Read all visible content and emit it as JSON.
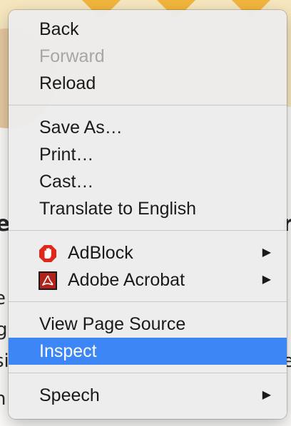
{
  "background_page": {
    "fragments": [
      "e",
      "r",
      "e",
      "g",
      "si",
      "ee",
      "h"
    ]
  },
  "context_menu": {
    "groups": [
      [
        {
          "label": "Back",
          "enabled": true
        },
        {
          "label": "Forward",
          "enabled": false
        },
        {
          "label": "Reload",
          "enabled": true
        }
      ],
      [
        {
          "label": "Save As…",
          "enabled": true
        },
        {
          "label": "Print…",
          "enabled": true
        },
        {
          "label": "Cast…",
          "enabled": true
        },
        {
          "label": "Translate to English",
          "enabled": true
        }
      ],
      [
        {
          "label": "AdBlock",
          "icon": "adblock-hand-icon",
          "submenu": true
        },
        {
          "label": "Adobe Acrobat",
          "icon": "adobe-acrobat-icon",
          "submenu": true
        }
      ],
      [
        {
          "label": "View Page Source",
          "enabled": true
        },
        {
          "label": "Inspect",
          "enabled": true,
          "highlighted": true
        }
      ],
      [
        {
          "label": "Speech",
          "submenu": true
        }
      ]
    ],
    "submenu_glyph": "▶",
    "highlight_color": "#3d86f5",
    "adblock_color": "#e0271b",
    "acrobat_color": "#b3221a"
  }
}
